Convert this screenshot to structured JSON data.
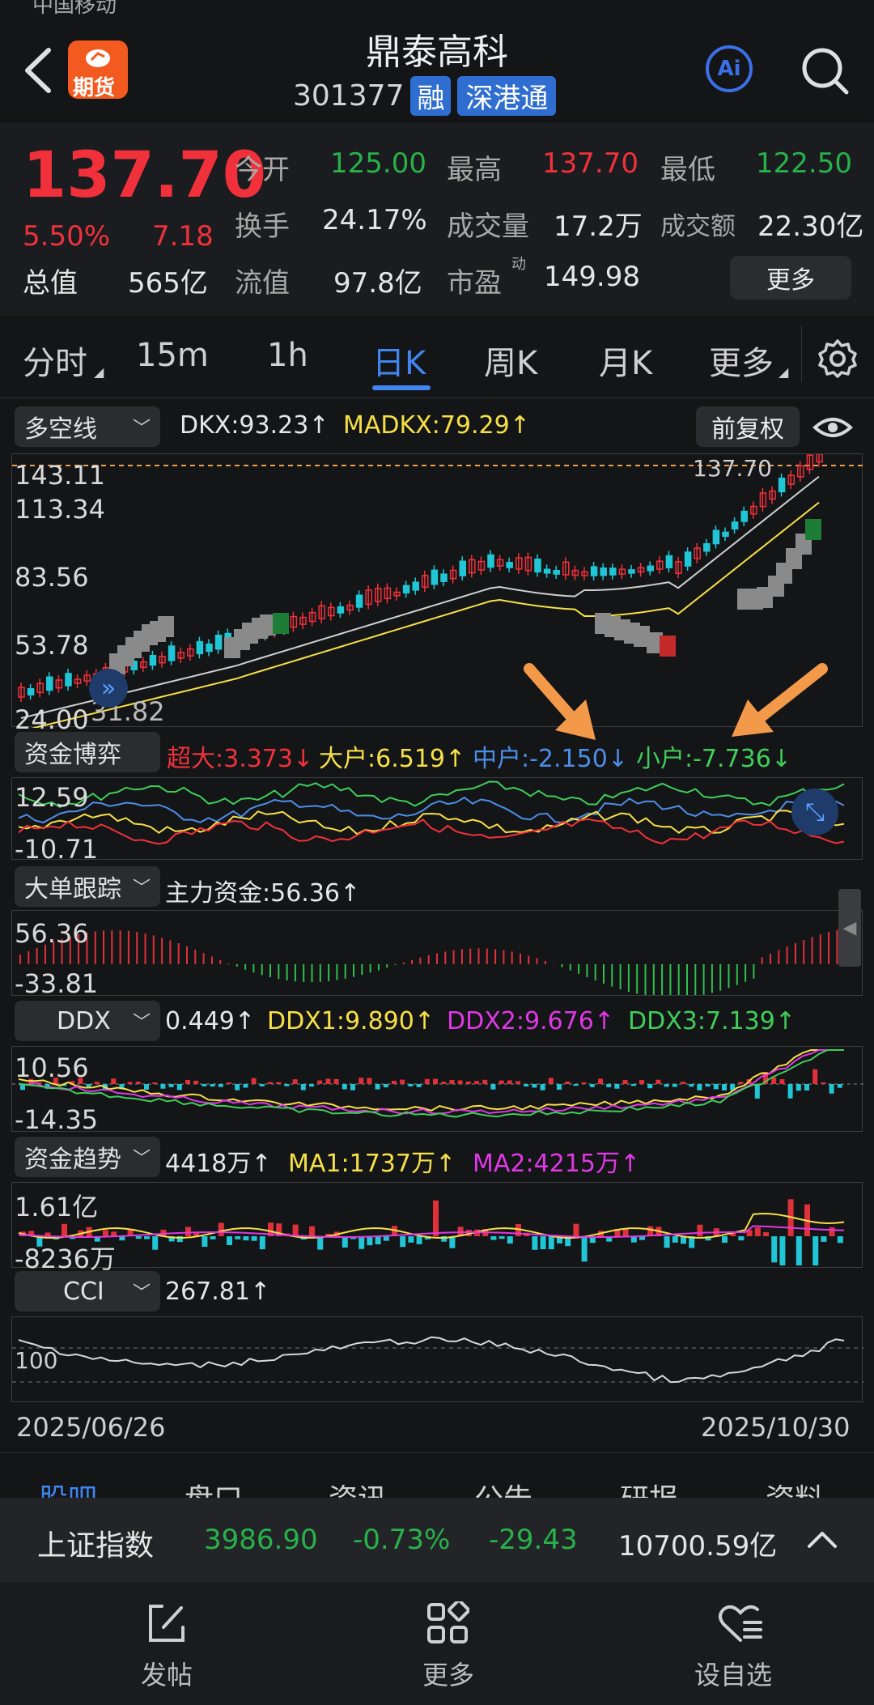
{
  "status_bar": {
    "carrier": "中国移动"
  },
  "header": {
    "title": "鼎泰高科",
    "code": "301377",
    "badge_rong": "融",
    "badge_sgt": "深港通",
    "futures_label": "期货",
    "ai_label": "Ai"
  },
  "quote": {
    "price": "137.70",
    "change_pct": "5.50%",
    "change": "7.18",
    "total_value_label": "总值",
    "total_value": "565亿",
    "stats": [
      {
        "label": "今开",
        "value": "125.00",
        "color": "green"
      },
      {
        "label": "最高",
        "value": "137.70",
        "color": "red"
      },
      {
        "label": "最低",
        "value": "122.50",
        "color": "green"
      },
      {
        "label": "换手",
        "value": "24.17%",
        "color": "white"
      },
      {
        "label": "成交量",
        "value": "17.2万",
        "color": "white"
      },
      {
        "label": "成交额",
        "value": "22.30亿",
        "color": "white"
      },
      {
        "label": "流值",
        "value": "97.8亿",
        "color": "white"
      },
      {
        "label": "市盈",
        "sup": "动",
        "value": "149.98",
        "color": "white"
      }
    ],
    "more_button": "更多"
  },
  "period_tabs": [
    {
      "label": "分时",
      "active": false
    },
    {
      "label": "15m",
      "active": false
    },
    {
      "label": "1h",
      "active": false
    },
    {
      "label": "日K",
      "active": true
    },
    {
      "label": "周K",
      "active": false
    },
    {
      "label": "月K",
      "active": false
    },
    {
      "label": "更多",
      "active": false
    }
  ],
  "main_chart": {
    "indicator_select": "多空线",
    "dkx": "DKX:93.23↑",
    "madkx": "MADKX:79.29↑",
    "adjust_button": "前复权",
    "price_marker": "137.70",
    "y_labels": [
      "143.11",
      "113.34",
      "83.56",
      "53.78",
      "24.00"
    ],
    "low_marker": "31.82",
    "nine_turn_counts": [
      "1",
      "2",
      "3",
      "4",
      "5",
      "6",
      "7",
      "8",
      "9"
    ]
  },
  "fund_game": {
    "select": "资金博弈",
    "super": "超大:3.373↓",
    "big": "大户:6.519↑",
    "mid": "中户:-2.150↓",
    "small": "小户:-7.736↓",
    "y_labels": [
      "12.59",
      "-10.71"
    ]
  },
  "big_order": {
    "select": "大单跟踪",
    "main_fund": "主力资金:56.36↑",
    "y_labels": [
      "56.36",
      "-33.81"
    ]
  },
  "ddx": {
    "select": "DDX",
    "value": "0.449↑",
    "ddx1": "DDX1:9.890↑",
    "ddx2": "DDX2:9.676↑",
    "ddx3": "DDX3:7.139↑",
    "y_labels": [
      "10.56",
      "-14.35"
    ]
  },
  "fund_trend": {
    "select": "资金趋势",
    "value": "4418万↑",
    "ma1": "MA1:1737万↑",
    "ma2": "MA2:4215万↑",
    "y_labels": [
      "1.61亿",
      "-8236万"
    ]
  },
  "cci": {
    "select": "CCI",
    "value": "267.81↑",
    "y_label": "100"
  },
  "date_range": {
    "start": "2025/06/26",
    "end": "2025/10/30"
  },
  "bottom_tabs": [
    "股吧",
    "盘口",
    "资讯",
    "公告",
    "研报",
    "资料"
  ],
  "index_bar": {
    "name": "上证指数",
    "price": "3986.90",
    "pct": "-0.73%",
    "change": "-29.43",
    "amount": "10700.59亿"
  },
  "bottom_nav": [
    {
      "label": "发帖",
      "icon": "edit-icon"
    },
    {
      "label": "更多",
      "icon": "grid-icon"
    },
    {
      "label": "设自选",
      "icon": "heart-list-icon"
    }
  ]
}
